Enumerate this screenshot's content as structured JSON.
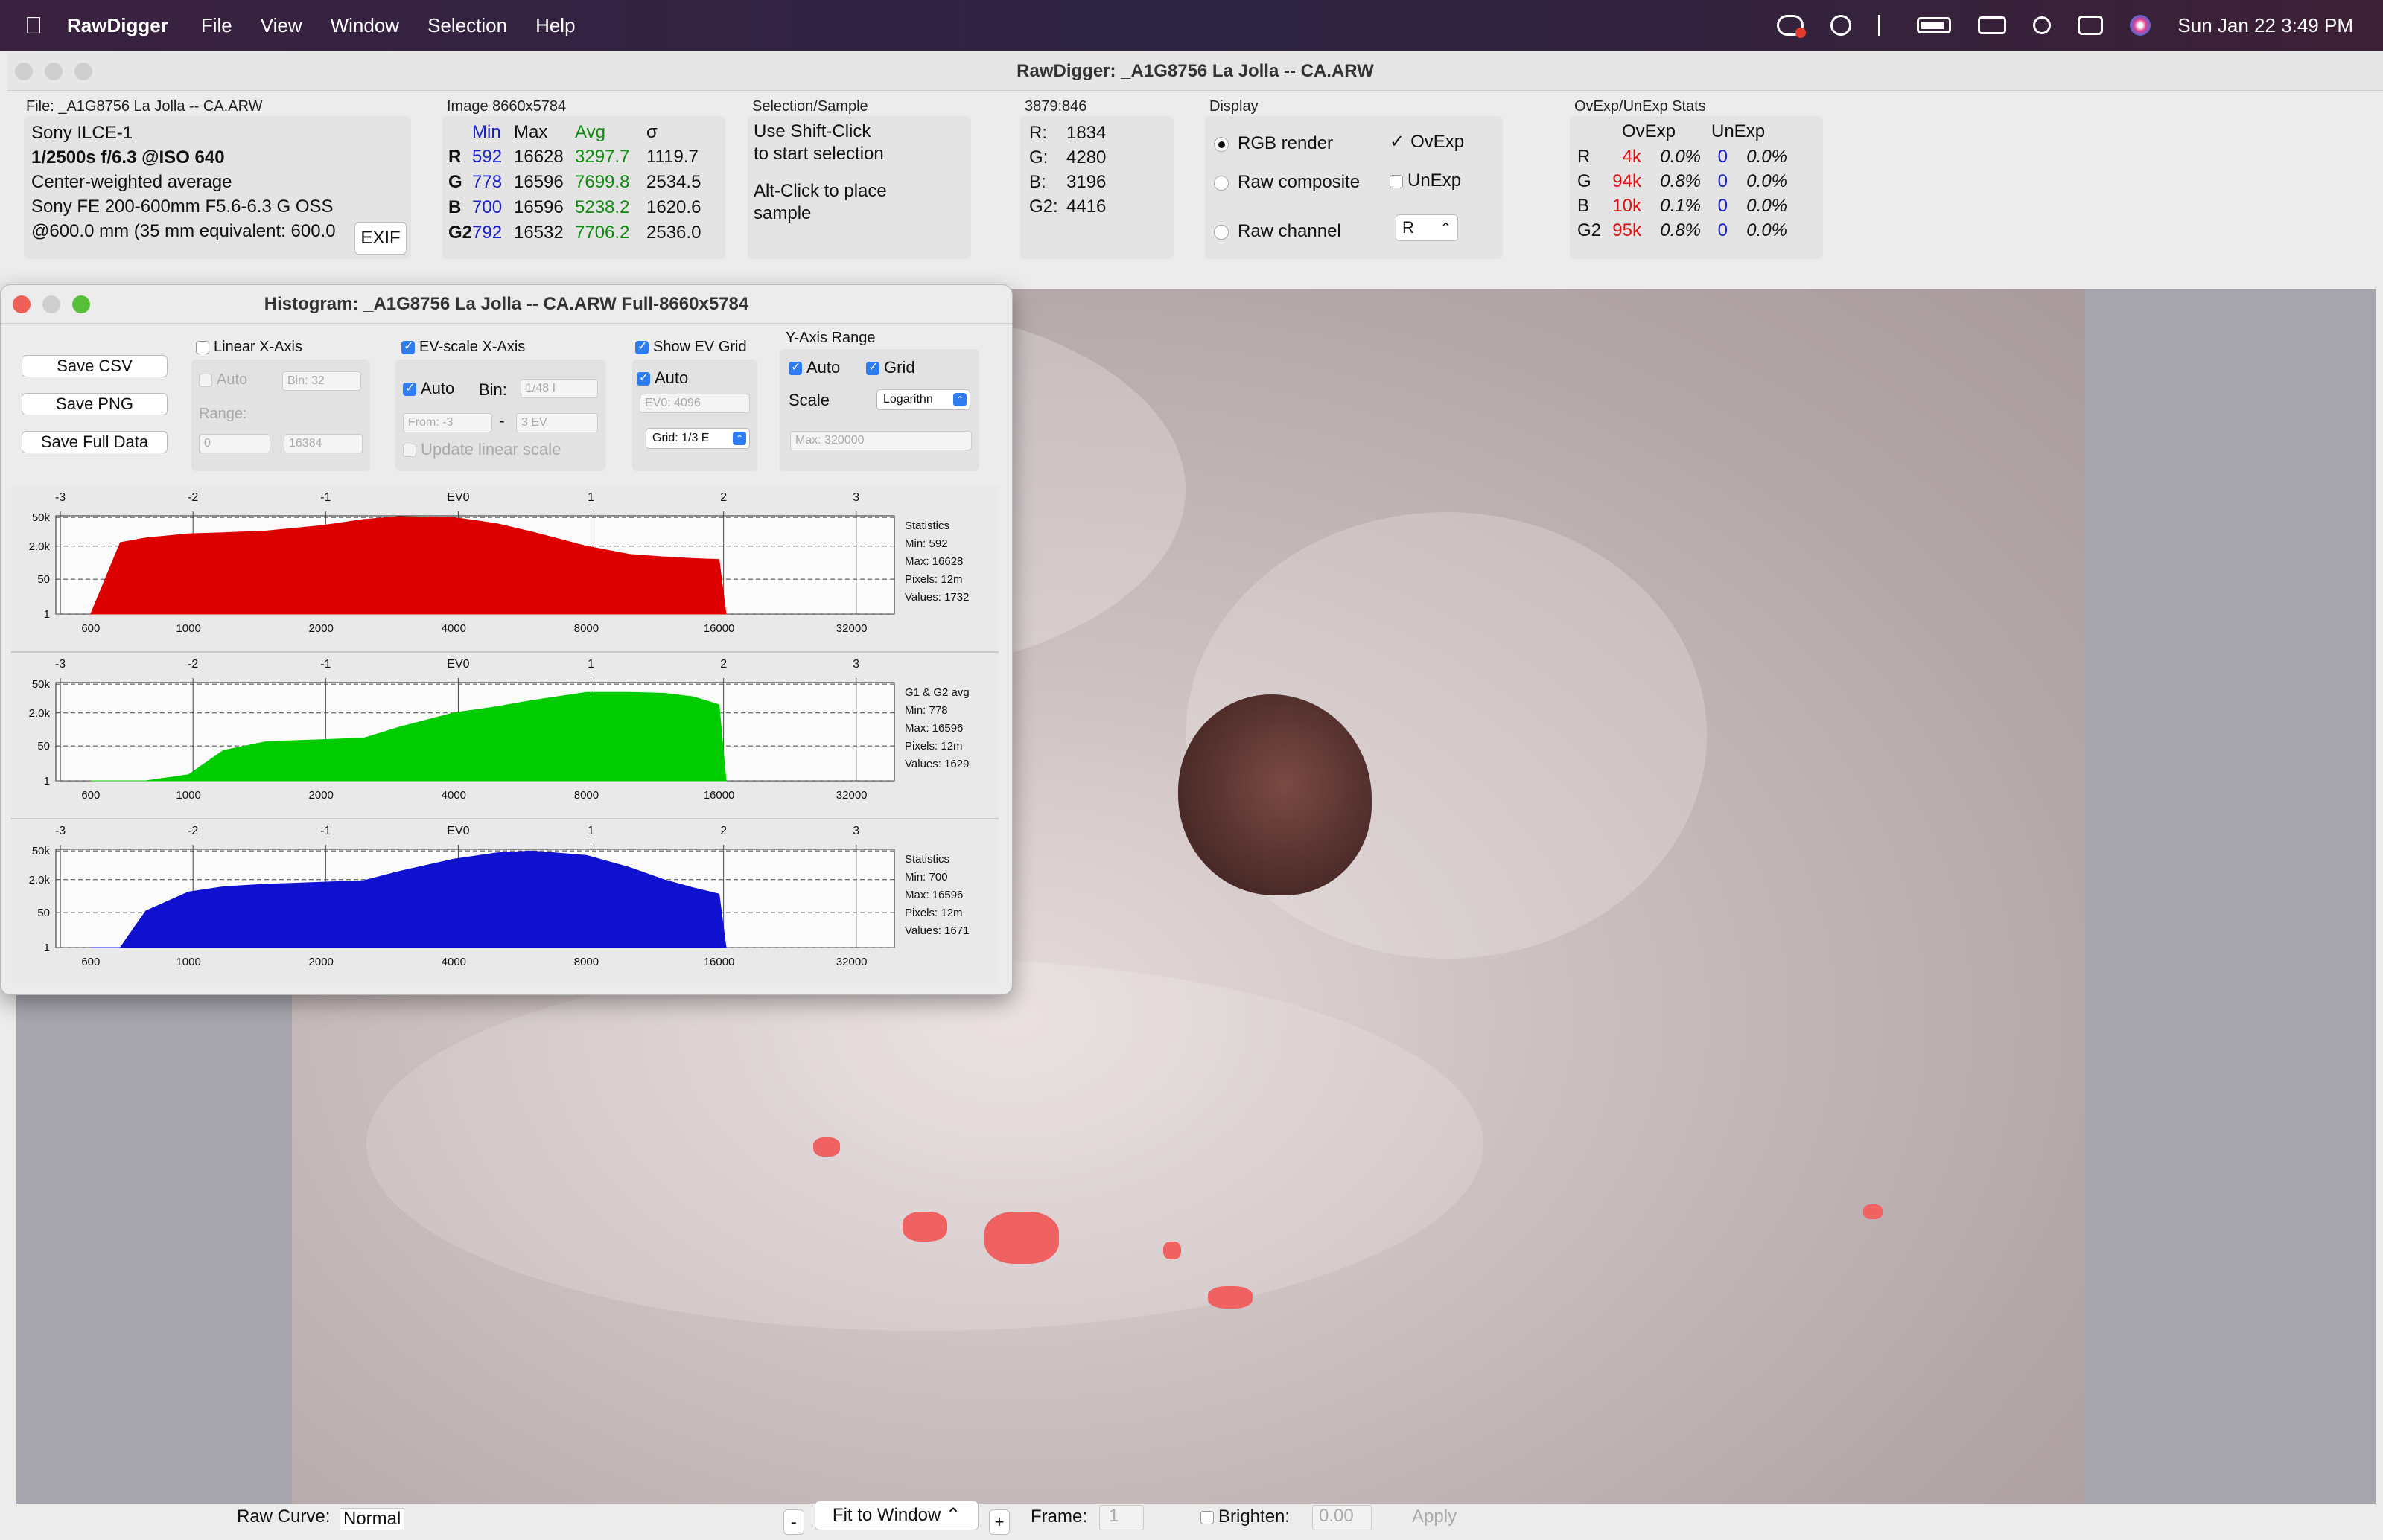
{
  "menubar": {
    "app": "RawDigger",
    "items": [
      "File",
      "View",
      "Window",
      "Selection",
      "Help"
    ],
    "clock": "Sun Jan 22  3:49 PM"
  },
  "window": {
    "title": "RawDigger: _A1G8756 La Jolla  -- CA.ARW"
  },
  "file_panel": {
    "label": "File: _A1G8756 La Jolla  -- CA.ARW",
    "lines": [
      "Sony ILCE-1",
      "1/2500s f/6.3 @ISO 640",
      "Center-weighted average",
      "Sony FE 200-600mm F5.6-6.3 G OSS",
      "@600.0 mm (35 mm equivalent: 600.0"
    ],
    "exif_button": "EXIF"
  },
  "image_panel": {
    "label": "Image 8660x5784",
    "headers": [
      "Min",
      "Max",
      "Avg",
      "σ"
    ],
    "rows": [
      {
        "ch": "R",
        "min": "592",
        "max": "16628",
        "avg": "3297.7",
        "sd": "1119.7"
      },
      {
        "ch": "G",
        "min": "778",
        "max": "16596",
        "avg": "7699.8",
        "sd": "2534.5"
      },
      {
        "ch": "B",
        "min": "700",
        "max": "16596",
        "avg": "5238.2",
        "sd": "1620.6"
      },
      {
        "ch": "G2",
        "min": "792",
        "max": "16532",
        "avg": "7706.2",
        "sd": "2536.0"
      }
    ]
  },
  "selection_panel": {
    "label": "Selection/Sample",
    "line1": "Use Shift-Click",
    "line2": "to start selection",
    "line3": "Alt-Click to place",
    "line4": "sample"
  },
  "coords_panel": {
    "label": "3879:846",
    "rows": [
      {
        "k": "R:",
        "v": "1834"
      },
      {
        "k": "G:",
        "v": "4280"
      },
      {
        "k": "B:",
        "v": "3196"
      },
      {
        "k": "G2:",
        "v": "4416"
      }
    ]
  },
  "display_panel": {
    "label": "Display",
    "rgb_render": "RGB render",
    "raw_composite": "Raw composite",
    "raw_channel": "Raw channel",
    "ovexp": "OvExp",
    "unexp": "UnExp",
    "channel_value": "R",
    "selected_mode": "RGB render"
  },
  "stats_panel": {
    "label": "OvExp/UnExp Stats",
    "headers": [
      "OvExp",
      "UnExp"
    ],
    "rows": [
      {
        "ch": "R",
        "ov": "4k",
        "ovp": "0.0%",
        "un": "0",
        "unp": "0.0%"
      },
      {
        "ch": "G",
        "ov": "94k",
        "ovp": "0.8%",
        "un": "0",
        "unp": "0.0%"
      },
      {
        "ch": "B",
        "ov": "10k",
        "ovp": "0.1%",
        "un": "0",
        "unp": "0.0%"
      },
      {
        "ch": "G2",
        "ov": "95k",
        "ovp": "0.8%",
        "un": "0",
        "unp": "0.0%"
      }
    ]
  },
  "histogram": {
    "title": "Histogram: _A1G8756 La Jolla  -- CA.ARW Full-8660x5784",
    "buttons": [
      "Save CSV",
      "Save PNG",
      "Save Full Data"
    ],
    "linear": {
      "label": "Linear X-Axis",
      "auto": "Auto",
      "bin": "Bin: 32",
      "range": "Range:",
      "from": "0",
      "to": "16384"
    },
    "ev": {
      "label": "EV-scale X-Axis",
      "auto": "Auto",
      "bin_label": "Bin:",
      "bin": "1/48 I",
      "from": "From: -3",
      "to": "3 EV",
      "update": "Update linear scale"
    },
    "evgrid": {
      "label": "Show EV Grid",
      "auto": "Auto",
      "ev0": "EV0: 4096",
      "grid": "Grid: 1/3 E"
    },
    "yaxis": {
      "label": "Y-Axis Range",
      "auto": "Auto",
      "grid": "Grid",
      "scale": "Scale",
      "scale_value": "Logarithn",
      "max": "Max: 320000"
    },
    "ev_ticks": [
      "-3",
      "-2",
      "-1",
      "EV0",
      "1",
      "2",
      "3"
    ],
    "x_ticks": [
      "600",
      "1000",
      "2000",
      "4000",
      "8000",
      "16000",
      "32000"
    ],
    "y_ticks": [
      "50k",
      "2.0k",
      "50",
      "1"
    ],
    "stats": [
      {
        "title": "Statistics",
        "min": "Min: 592",
        "max": "Max: 16628",
        "pixels": "Pixels: 12m",
        "values": "Values: 1732",
        "color": "#dd0000"
      },
      {
        "title": "G1 & G2 avg",
        "min": "Min: 778",
        "max": "Max: 16596",
        "pixels": "Pixels: 12m",
        "values": "Values: 1629",
        "color": "#00cc00"
      },
      {
        "title": "Statistics",
        "min": "Min: 700",
        "max": "Max: 16596",
        "pixels": "Pixels: 12m",
        "values": "Values: 1671",
        "color": "#1010d0"
      }
    ]
  },
  "chart_data": {
    "type": "area",
    "xlabel": "",
    "ylabel": "",
    "x_scale": "log",
    "y_scale": "log",
    "x": [
      600,
      700,
      800,
      1000,
      1200,
      1500,
      2000,
      2500,
      3000,
      4000,
      5000,
      6000,
      8000,
      10000,
      12000,
      14000,
      16000,
      16600
    ],
    "series": [
      {
        "name": "R",
        "values": [
          1,
          3000,
          5000,
          8000,
          9000,
          11000,
          20000,
          40000,
          55000,
          50000,
          25000,
          10000,
          2000,
          800,
          600,
          500,
          450,
          0
        ]
      },
      {
        "name": "G",
        "values": [
          0,
          0,
          0,
          2,
          30,
          80,
          100,
          120,
          400,
          2000,
          4000,
          8000,
          20000,
          20000,
          18000,
          12000,
          5000,
          0
        ]
      },
      {
        "name": "B",
        "values": [
          0,
          1,
          60,
          500,
          900,
          1200,
          1500,
          1800,
          5000,
          20000,
          40000,
          50000,
          30000,
          8000,
          2000,
          800,
          400,
          0
        ]
      }
    ]
  },
  "bottom": {
    "raw_curve_label": "Raw Curve:",
    "raw_curve_value": "Normal",
    "minus": "-",
    "fit": "Fit to Window",
    "plus": "+",
    "frame_label": "Frame:",
    "frame_value": "1",
    "brighten_label": "Brighten:",
    "brighten_value": "0.00",
    "apply": "Apply"
  }
}
